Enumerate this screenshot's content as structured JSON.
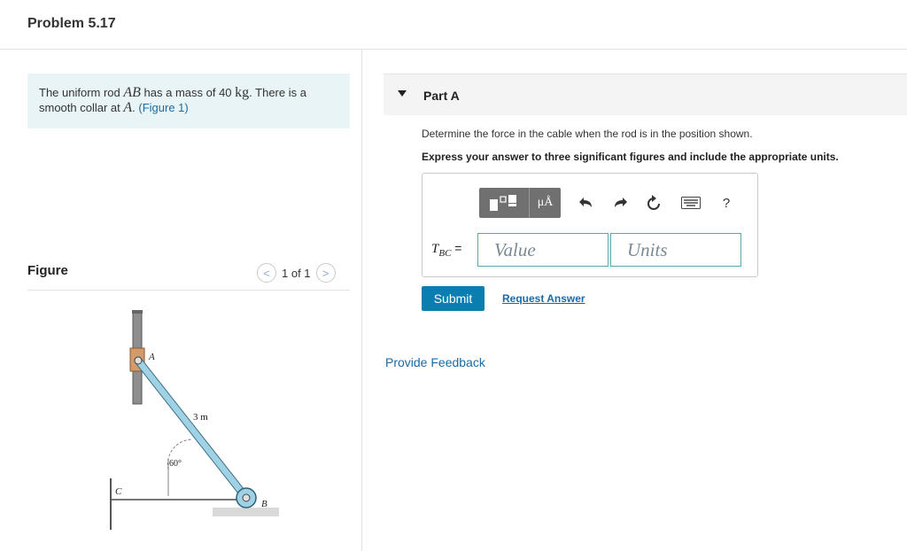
{
  "problem": {
    "title": "Problem 5.17"
  },
  "statement": {
    "t1": "The uniform rod ",
    "rod": "AB",
    "t2": " has a mass of 40 ",
    "unit": "kg",
    "t3": ". There is a smooth collar at ",
    "collar": "A",
    "t4": ". ",
    "figure_link": "(Figure 1)"
  },
  "figure": {
    "label": "Figure",
    "pager": "1 of 1",
    "prev_glyph": "<",
    "next_glyph": ">",
    "labels": {
      "a": "A",
      "b": "B",
      "c": "C",
      "length": "3 m",
      "angle": "60°"
    }
  },
  "part_a": {
    "label": "Part A",
    "question": "Determine the force in the cable when the rod is in the position shown.",
    "instruction": "Express your answer to three significant figures and include the appropriate units.",
    "toolbar": {
      "units_glyph": "μÅ",
      "icons": [
        "templates-icon",
        "units-icon",
        "undo-icon",
        "redo-icon",
        "reset-icon",
        "keyboard-icon",
        "help-icon"
      ],
      "help_glyph": "?"
    },
    "answer": {
      "var_symbol": "T",
      "var_sub": "BC",
      "equals": " =",
      "value_placeholder": "Value",
      "units_placeholder": "Units"
    },
    "submit_label": "Submit",
    "request_label": "Request Answer"
  },
  "feedback_label": "Provide Feedback",
  "colors": {
    "accent": "#0b7eb0",
    "link": "#1a6aa5",
    "statement_bg": "#e8f4f5",
    "rod": "#9fd2e4",
    "field_border": "#5aa6b0"
  }
}
